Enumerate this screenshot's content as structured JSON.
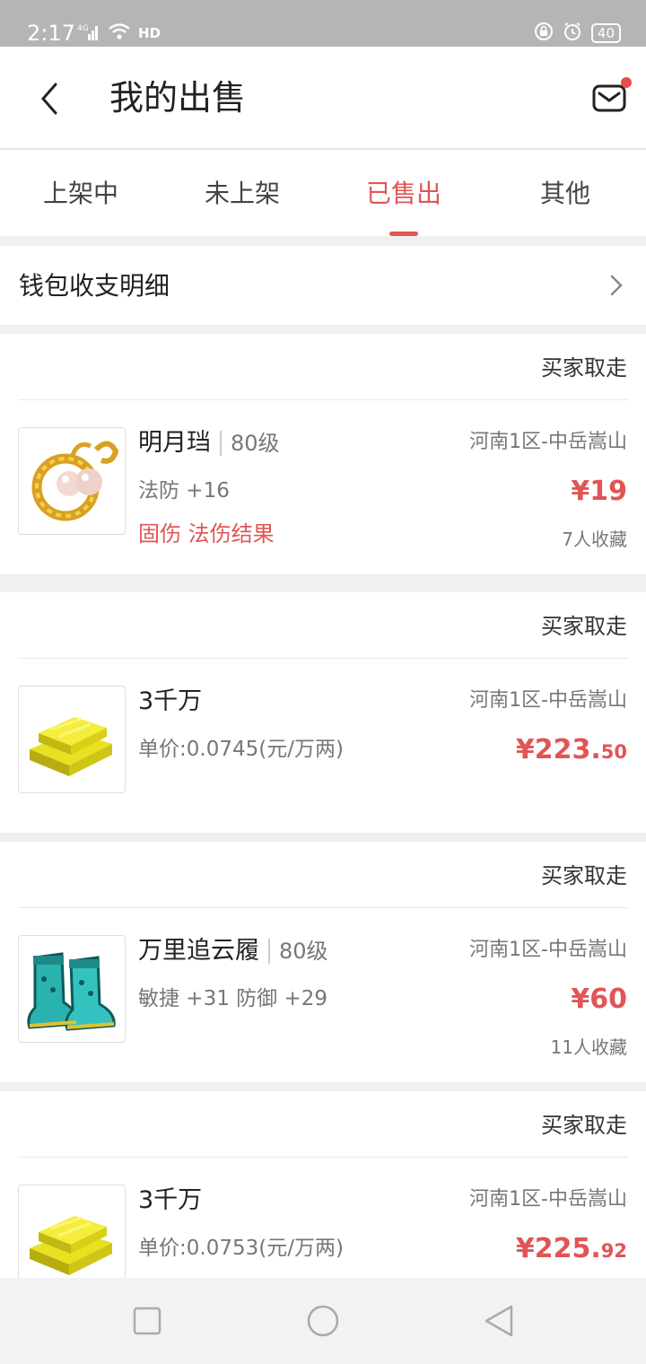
{
  "status_bar": {
    "time": "2:17",
    "network": "4G",
    "hd": "HD",
    "battery": "40"
  },
  "header": {
    "title": "我的出售"
  },
  "tabs": [
    {
      "label": "上架中"
    },
    {
      "label": "未上架"
    },
    {
      "label": "已售出"
    },
    {
      "label": "其他"
    }
  ],
  "wallet": {
    "label": "钱包收支明细"
  },
  "items": [
    {
      "status": "买家取走",
      "name": "明月珰",
      "level": "80级",
      "attr": "法防 +16",
      "tags": "固伤 法伤结果",
      "server": "河南1区-中岳嵩山",
      "price_int": "¥19",
      "price_dec": "",
      "favorites": "7人收藏",
      "icon": "earring-icon"
    },
    {
      "status": "买家取走",
      "name": "3千万",
      "level": "",
      "attr": "单价:0.0745(元/万两)",
      "tags": "",
      "server": "河南1区-中岳嵩山",
      "price_int": "¥223.",
      "price_dec": "50",
      "favorites": "",
      "icon": "gold-bar-icon"
    },
    {
      "status": "买家取走",
      "name": "万里追云履",
      "level": "80级",
      "attr": "敏捷 +31 防御 +29",
      "tags": "",
      "server": "河南1区-中岳嵩山",
      "price_int": "¥60",
      "price_dec": "",
      "favorites": "11人收藏",
      "icon": "boots-icon"
    },
    {
      "status": "买家取走",
      "name": "3千万",
      "level": "",
      "attr": "单价:0.0753(元/万两)",
      "tags": "",
      "server": "河南1区-中岳嵩山",
      "price_int": "¥225.",
      "price_dec": "92",
      "favorites": "",
      "icon": "gold-bar-icon"
    }
  ],
  "colors": {
    "accent": "#e05555",
    "tab_indicator": "#e05555"
  }
}
